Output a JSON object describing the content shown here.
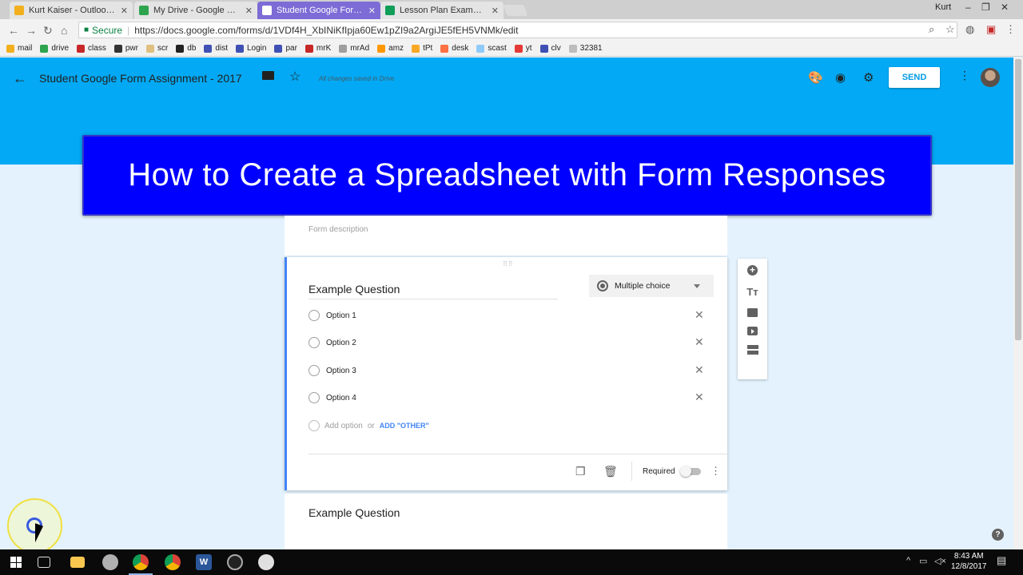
{
  "browser": {
    "tabs": [
      {
        "label": "Kurt Kaiser - Outlook W",
        "close": "✕",
        "color": "#f2b01e"
      },
      {
        "label": "My Drive - Google Drive",
        "close": "✕",
        "color": "#2ea44f"
      },
      {
        "label": "Student Google Form A",
        "close": "✕",
        "color": "#ffffff"
      },
      {
        "label": "Lesson Plan Example Stu",
        "close": "✕",
        "color": "#0f9d58"
      }
    ],
    "user": "Kurt",
    "window_controls": [
      "–",
      "❐",
      "✕"
    ],
    "secure_label": "Secure",
    "url": "https://docs.google.com/forms/d/1VDf4H_XbINiKfIpja60Ew1pZI9a2ArgiJE5fEH5VNMk/edit",
    "bookmarks": [
      {
        "label": "mail",
        "color": "#f2b01e"
      },
      {
        "label": "drive",
        "color": "#2ea44f"
      },
      {
        "label": "class",
        "color": "#c62828"
      },
      {
        "label": "pwr",
        "color": "#333333"
      },
      {
        "label": "scr",
        "color": "#e0c080"
      },
      {
        "label": "db",
        "color": "#222222"
      },
      {
        "label": "dist",
        "color": "#3f51b5"
      },
      {
        "label": "Login",
        "color": "#3f51b5"
      },
      {
        "label": "par",
        "color": "#3f51b5"
      },
      {
        "label": "mrK",
        "color": "#c62828"
      },
      {
        "label": "mrAd",
        "color": "#9e9e9e"
      },
      {
        "label": "amz",
        "color": "#ff9800"
      },
      {
        "label": "tPt",
        "color": "#f9a825"
      },
      {
        "label": "desk",
        "color": "#ff7043"
      },
      {
        "label": "scast",
        "color": "#90caf9"
      },
      {
        "label": "yt",
        "color": "#e53935"
      },
      {
        "label": "clv",
        "color": "#3f51b5"
      },
      {
        "label": "32381",
        "color": "#bdbdbd"
      }
    ]
  },
  "header": {
    "title": "Student Google Form Assignment - 2017",
    "saved_status": "All changes saved in Drive",
    "send_label": "SEND"
  },
  "banner": {
    "text": "How to Create a Spreadsheet with Form Responses"
  },
  "form": {
    "description_placeholder": "Form description",
    "question": {
      "title": "Example Question",
      "type": "Multiple choice",
      "options": [
        "Option 1",
        "Option 2",
        "Option 3",
        "Option 4"
      ],
      "add_option": "Add option",
      "or": "or",
      "add_other": "ADD \"OTHER\"",
      "required_label": "Required",
      "required": false
    },
    "next_question_title": "Example Question"
  },
  "taskbar": {
    "time": "8:43 AM",
    "date": "12/8/2017"
  },
  "colors": {
    "header": "#03a9f4",
    "banner": "#0000ff",
    "accent": "#4285f4",
    "page_bg": "#e3f2fd"
  }
}
